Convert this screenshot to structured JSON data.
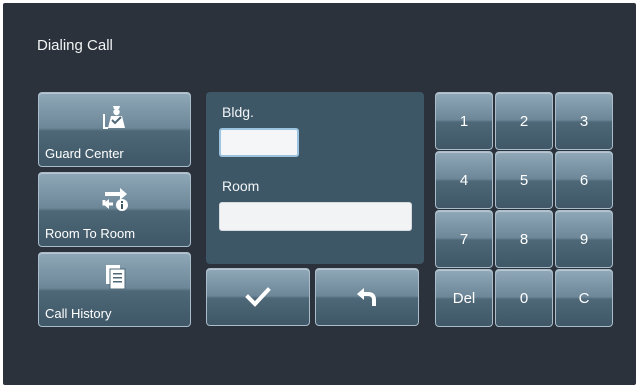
{
  "header": {
    "title": "Dialing Call"
  },
  "sidebar": {
    "items": [
      {
        "label": "Guard Center",
        "icon": "guard-icon"
      },
      {
        "label": "Room To Room",
        "icon": "room-transfer-icon"
      },
      {
        "label": "Call History",
        "icon": "call-history-icon"
      }
    ]
  },
  "form": {
    "bldg_label": "Bldg.",
    "bldg_value": "",
    "room_label": "Room",
    "room_value": ""
  },
  "actions": {
    "confirm_icon": "checkmark-icon",
    "back_icon": "back-arrow-icon"
  },
  "keypad": {
    "keys": [
      "1",
      "2",
      "3",
      "4",
      "5",
      "6",
      "7",
      "8",
      "9",
      "Del",
      "0",
      "C"
    ]
  },
  "colors": {
    "background": "#2b323b",
    "button": "#6d8798",
    "panel": "#3e5766"
  }
}
